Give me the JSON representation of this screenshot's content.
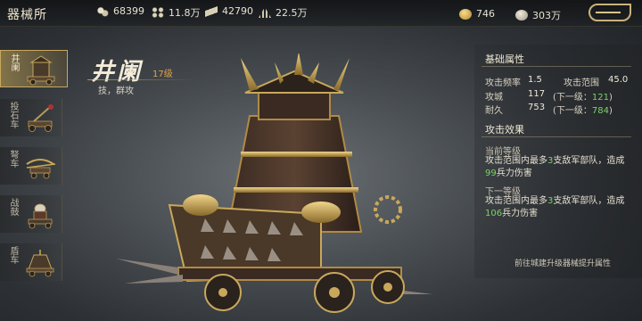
{
  "header": {
    "title": "器械所",
    "resources": [
      {
        "icon": "grain-icon",
        "value": "68399"
      },
      {
        "icon": "wood-icon",
        "value": "11.8万"
      },
      {
        "icon": "iron-icon",
        "value": "42790"
      },
      {
        "icon": "stone-icon",
        "value": "22.5万"
      }
    ],
    "coin": {
      "icon": "coin-icon",
      "value": "746"
    },
    "gem": {
      "icon": "gem-icon",
      "value": "303万"
    },
    "back_icon": "back-arrow-icon"
  },
  "sidebar": {
    "items": [
      {
        "label": "井阑",
        "active": true
      },
      {
        "label": "投石车",
        "active": false
      },
      {
        "label": "弩车",
        "active": false
      },
      {
        "label": "战鼓",
        "active": false
      },
      {
        "label": "盾车",
        "active": false
      }
    ]
  },
  "unit": {
    "name": "井阑",
    "level": "17级",
    "tags": "技，群攻"
  },
  "panel": {
    "basic_title": "基础属性",
    "freq_label": "攻击频率",
    "freq_value": "1.5",
    "range_label": "攻击范围",
    "range_value": "45.0",
    "siege_label": "攻城",
    "siege_value": "117",
    "siege_next_prefix": "(下一级：",
    "siege_next": "121",
    "close_paren": ")",
    "dura_label": "耐久",
    "dura_value": "753",
    "dura_next_prefix": "(下一级：",
    "dura_next": "784",
    "effect_title": "攻击效果",
    "current_label": "当前等级",
    "current_desc_1": "攻击范围内最多",
    "current_num": "3",
    "current_desc_2": "支敌军部队，造成",
    "current_dmg": "99",
    "current_desc_3": "兵力伤害",
    "next_label": "下一等级",
    "next_desc_1": "攻击范围内最多",
    "next_num": "3",
    "next_desc_2": "支敌军部队，造成",
    "next_dmg": "106",
    "next_desc_3": "兵力伤害",
    "upgrade_link": "前往城建升级器械提升属性"
  }
}
